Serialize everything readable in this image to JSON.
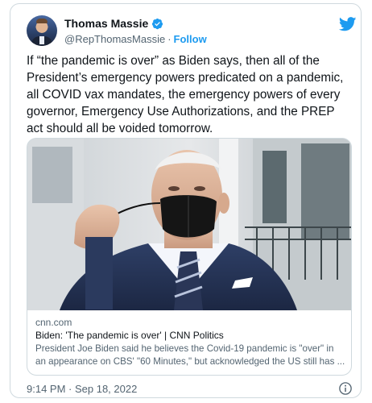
{
  "author": {
    "name": "Thomas Massie",
    "handle": "@RepThomasMassie",
    "separator": "·",
    "follow_label": "Follow"
  },
  "tweet": {
    "text": "If “the pandemic is over” as Biden says, then all of the President’s emergency powers predicated on a pandemic, all COVID vax mandates, the emergency powers of every governor, Emergency Use Authorizations, and the PREP act should all be voided tomorrow.",
    "timestamp": "9:14 PM · Sep 18, 2022"
  },
  "link_card": {
    "domain": "cnn.com",
    "title": "Biden: 'The pandemic is over' | CNN Politics",
    "description": "President Joe Biden said he believes the Covid-19 pandemic is \"over\" in an appearance on CBS' \"60 Minutes,\" but acknowledged the US still has ..."
  },
  "icons": {
    "verified": "verified-badge-icon",
    "brand": "twitter-bird-icon",
    "info": "info-icon"
  },
  "colors": {
    "brand_blue": "#1d9bf0",
    "text_primary": "#0f1419",
    "text_secondary": "#536471",
    "border": "#cfd9de"
  }
}
